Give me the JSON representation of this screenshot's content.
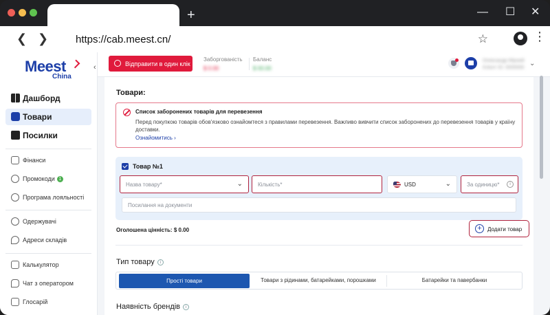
{
  "browser": {
    "url": "https://cab.meest.cn/",
    "new_tab": "+",
    "win_min": "—",
    "win_max": "☐",
    "win_close": "✕",
    "back": "❮",
    "forward": "❯",
    "star": "☆",
    "menu": "⋮",
    "colors": {
      "close": "#ed5f57",
      "minimize": "#f5bd4f",
      "maximize": "#5fc350"
    }
  },
  "logo": {
    "main": "Meest",
    "sub": "China"
  },
  "sidebar": {
    "primary": [
      {
        "label": "Дашборд",
        "icon": "dashboard-icon"
      },
      {
        "label": "Товари",
        "icon": "goods-icon",
        "active": true
      },
      {
        "label": "Посилки",
        "icon": "parcel-icon"
      }
    ],
    "group1": [
      {
        "label": "Фінанси",
        "icon": "wallet-icon"
      },
      {
        "label": "Промокоди",
        "icon": "percent-icon",
        "badge": "1"
      },
      {
        "label": "Програма лояльності",
        "icon": "loyalty-icon"
      }
    ],
    "group2": [
      {
        "label": "Одержувачі",
        "icon": "users-icon"
      },
      {
        "label": "Адреси складів",
        "icon": "location-icon"
      }
    ],
    "group3": [
      {
        "label": "Калькулятор",
        "icon": "calculator-icon"
      },
      {
        "label": "Чат з оператором",
        "icon": "chat-icon"
      },
      {
        "label": "Глосарій",
        "icon": "glossary-icon"
      }
    ]
  },
  "topbar": {
    "collapse": "‹",
    "send_button": "Відправити в один клік",
    "debt_label": "Заборгованість",
    "debt_value": "$ 0.00",
    "balance_label": "Баланс",
    "balance_value": "$ 00.00",
    "user_name": "Олександр Мірний",
    "user_id": "Клієнт ID: 0000000",
    "chevron": "⌄"
  },
  "main": {
    "goods_title": "Товари:",
    "alert": {
      "title": "Список заборонених товарів для перевезення",
      "text": "Перед покупкою товарів обов'язково ознайомтеся з правилами перевезення. Важливо вивчити список заборонених до перевезення товарів у країну доставки.",
      "link": "Ознайомитись  ›"
    },
    "item": {
      "title": "Товар №1",
      "name_placeholder": "Назва товару*",
      "qty_placeholder": "Кількість*",
      "currency": "USD",
      "price_placeholder": "За одиницю*",
      "doc_placeholder": "Посилання на документи",
      "chevron": "⌄",
      "info": "i"
    },
    "declared_value": "Оголошена цінність: $ 0.00",
    "add_button": "Додати товар",
    "type_title": "Тип товару",
    "type_options": [
      "Прості товари",
      "Товари з рідинами, батарейками, порошками",
      "Батарейки та павербанки"
    ],
    "brands_title": "Наявність брендів"
  }
}
